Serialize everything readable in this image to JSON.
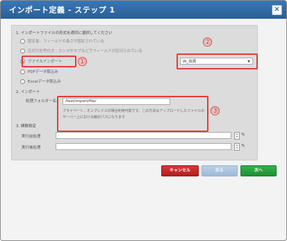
{
  "dialog": {
    "title": "インポート定義 - ステップ 1",
    "close": "×"
  },
  "section1": {
    "heading": "1. インポートファイルの形式を適切に選択してください",
    "options": [
      {
        "label": "固定長 - フィールドの長さが固定されている",
        "selected": false
      },
      {
        "label": "区切り記号付き - カンマやタブなどでフィールドが区切られている",
        "selected": false
      },
      {
        "label": "ファイルインポート",
        "selected": true
      },
      {
        "label": "PDFデータ取込み",
        "selected": false
      },
      {
        "label": "Excelデータ取込み",
        "selected": false
      }
    ],
    "select_value": "W_出資"
  },
  "section2": {
    "heading": "2. インポート",
    "folder_label": "処理フォルダー名:",
    "folder_value": "/test/import/file/",
    "note": "プライベート、オンプレミスの場合利用可能です。この方法はアップロードしたファイルのサーバー上における絶対パスになります"
  },
  "section3": {
    "heading": "3. 関数設定",
    "rows": [
      {
        "label": "実行前処理"
      },
      {
        "label": "実行後処理"
      }
    ]
  },
  "callouts": {
    "one": "①",
    "two": "②",
    "three": "③"
  },
  "buttons": {
    "cancel": "キャンセル",
    "back": "戻る",
    "next": "次へ"
  },
  "colors": {
    "title_bar": "#2b5e96",
    "callout": "#e23b3b",
    "cancel": "#c42626",
    "next": "#27a03c",
    "back_disabled": "#a9c4df"
  }
}
